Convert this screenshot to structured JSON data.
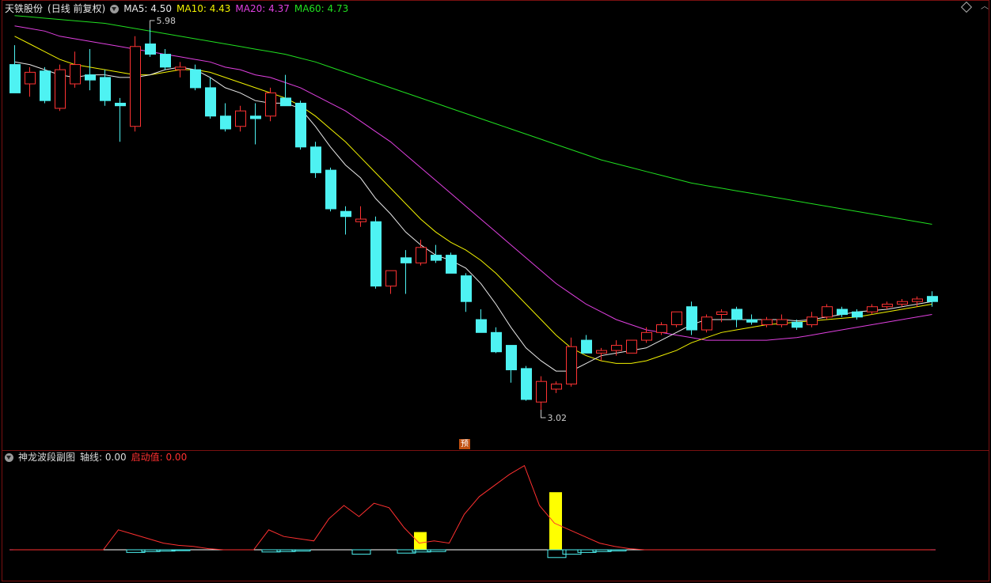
{
  "main_chart": {
    "stock_name": "天铁股份",
    "period_label": "(日线 前复权)",
    "indicators": [
      {
        "label": "MA5:",
        "value": "4.50",
        "color": "#e8e8e8"
      },
      {
        "label": "MA10:",
        "value": "4.43",
        "color": "#f2f200"
      },
      {
        "label": "MA20:",
        "value": "4.37",
        "color": "#e040e0"
      },
      {
        "label": "MA60:",
        "value": "4.73",
        "color": "#20e020"
      }
    ],
    "high_marker": "5.98",
    "low_marker": "3.02",
    "forecast_badge": "预"
  },
  "sub_chart": {
    "title": "神龙波段副图",
    "axis_label": "轴线:",
    "axis_value": "0.00",
    "trigger_label": "启动值:",
    "trigger_value": "0.00"
  },
  "colors": {
    "up": "#ff3333",
    "down": "#4ef2f2",
    "ma5": "#e8e8e8",
    "ma10": "#f2f200",
    "ma20": "#e040e0",
    "ma60": "#20e020",
    "frame": "#7a1010"
  },
  "chart_data": {
    "type": "candlestick",
    "price_range": [
      3.02,
      5.98
    ],
    "candles": [
      {
        "o": 5.7,
        "h": 5.85,
        "l": 5.5,
        "c": 5.48,
        "dir": "down"
      },
      {
        "o": 5.55,
        "h": 5.68,
        "l": 5.45,
        "c": 5.64,
        "dir": "up"
      },
      {
        "o": 5.65,
        "h": 5.68,
        "l": 5.4,
        "c": 5.42,
        "dir": "down"
      },
      {
        "o": 5.36,
        "h": 5.7,
        "l": 5.34,
        "c": 5.66,
        "dir": "up"
      },
      {
        "o": 5.55,
        "h": 5.8,
        "l": 5.52,
        "c": 5.7,
        "dir": "up"
      },
      {
        "o": 5.62,
        "h": 5.82,
        "l": 5.5,
        "c": 5.58,
        "dir": "down"
      },
      {
        "o": 5.6,
        "h": 5.66,
        "l": 5.38,
        "c": 5.42,
        "dir": "down"
      },
      {
        "o": 5.4,
        "h": 5.44,
        "l": 5.1,
        "c": 5.38,
        "dir": "down"
      },
      {
        "o": 5.22,
        "h": 5.92,
        "l": 5.18,
        "c": 5.84,
        "dir": "up"
      },
      {
        "o": 5.86,
        "h": 5.98,
        "l": 5.76,
        "c": 5.78,
        "dir": "down"
      },
      {
        "o": 5.78,
        "h": 5.82,
        "l": 5.66,
        "c": 5.68,
        "dir": "down"
      },
      {
        "o": 5.68,
        "h": 5.72,
        "l": 5.6,
        "c": 5.66,
        "dir": "up"
      },
      {
        "o": 5.66,
        "h": 5.7,
        "l": 5.5,
        "c": 5.52,
        "dir": "down"
      },
      {
        "o": 5.52,
        "h": 5.6,
        "l": 5.28,
        "c": 5.3,
        "dir": "down"
      },
      {
        "o": 5.3,
        "h": 5.4,
        "l": 5.18,
        "c": 5.2,
        "dir": "down"
      },
      {
        "o": 5.22,
        "h": 5.38,
        "l": 5.18,
        "c": 5.34,
        "dir": "up"
      },
      {
        "o": 5.3,
        "h": 5.4,
        "l": 5.08,
        "c": 5.28,
        "dir": "down"
      },
      {
        "o": 5.3,
        "h": 5.52,
        "l": 5.26,
        "c": 5.48,
        "dir": "up"
      },
      {
        "o": 5.44,
        "h": 5.62,
        "l": 5.38,
        "c": 5.38,
        "dir": "down"
      },
      {
        "o": 5.4,
        "h": 5.42,
        "l": 5.04,
        "c": 5.06,
        "dir": "down"
      },
      {
        "o": 5.06,
        "h": 5.1,
        "l": 4.82,
        "c": 4.86,
        "dir": "down"
      },
      {
        "o": 4.88,
        "h": 4.9,
        "l": 4.56,
        "c": 4.58,
        "dir": "down"
      },
      {
        "o": 4.56,
        "h": 4.6,
        "l": 4.38,
        "c": 4.52,
        "dir": "down"
      },
      {
        "o": 4.48,
        "h": 4.6,
        "l": 4.44,
        "c": 4.5,
        "dir": "up"
      },
      {
        "o": 4.48,
        "h": 4.52,
        "l": 3.96,
        "c": 3.98,
        "dir": "down"
      },
      {
        "o": 3.98,
        "h": 4.1,
        "l": 3.92,
        "c": 4.1,
        "dir": "up"
      },
      {
        "o": 4.2,
        "h": 4.26,
        "l": 3.92,
        "c": 4.16,
        "dir": "down"
      },
      {
        "o": 4.16,
        "h": 4.34,
        "l": 4.14,
        "c": 4.28,
        "dir": "up"
      },
      {
        "o": 4.22,
        "h": 4.3,
        "l": 4.16,
        "c": 4.18,
        "dir": "down"
      },
      {
        "o": 4.22,
        "h": 4.24,
        "l": 4.08,
        "c": 4.08,
        "dir": "down"
      },
      {
        "o": 4.06,
        "h": 4.08,
        "l": 3.78,
        "c": 3.86,
        "dir": "down"
      },
      {
        "o": 3.72,
        "h": 3.8,
        "l": 3.66,
        "c": 3.62,
        "dir": "down"
      },
      {
        "o": 3.62,
        "h": 3.66,
        "l": 3.46,
        "c": 3.47,
        "dir": "down"
      },
      {
        "o": 3.52,
        "h": 3.52,
        "l": 3.23,
        "c": 3.33,
        "dir": "down"
      },
      {
        "o": 3.34,
        "h": 3.36,
        "l": 3.09,
        "c": 3.1,
        "dir": "down"
      },
      {
        "o": 3.08,
        "h": 3.28,
        "l": 3.02,
        "c": 3.24,
        "dir": "up"
      },
      {
        "o": 3.18,
        "h": 3.24,
        "l": 3.15,
        "c": 3.22,
        "dir": "up"
      },
      {
        "o": 3.22,
        "h": 3.58,
        "l": 3.2,
        "c": 3.51,
        "dir": "up"
      },
      {
        "o": 3.56,
        "h": 3.6,
        "l": 3.46,
        "c": 3.46,
        "dir": "down"
      },
      {
        "o": 3.46,
        "h": 3.5,
        "l": 3.4,
        "c": 3.48,
        "dir": "up"
      },
      {
        "o": 3.48,
        "h": 3.56,
        "l": 3.44,
        "c": 3.52,
        "dir": "up"
      },
      {
        "o": 3.46,
        "h": 3.56,
        "l": 3.46,
        "c": 3.56,
        "dir": "up"
      },
      {
        "o": 3.56,
        "h": 3.66,
        "l": 3.54,
        "c": 3.62,
        "dir": "up"
      },
      {
        "o": 3.62,
        "h": 3.7,
        "l": 3.6,
        "c": 3.68,
        "dir": "up"
      },
      {
        "o": 3.68,
        "h": 3.78,
        "l": 3.66,
        "c": 3.78,
        "dir": "up"
      },
      {
        "o": 3.82,
        "h": 3.86,
        "l": 3.6,
        "c": 3.64,
        "dir": "down"
      },
      {
        "o": 3.64,
        "h": 3.76,
        "l": 3.62,
        "c": 3.74,
        "dir": "up"
      },
      {
        "o": 3.76,
        "h": 3.8,
        "l": 3.7,
        "c": 3.78,
        "dir": "up"
      },
      {
        "o": 3.8,
        "h": 3.82,
        "l": 3.66,
        "c": 3.72,
        "dir": "down"
      },
      {
        "o": 3.72,
        "h": 3.76,
        "l": 3.68,
        "c": 3.7,
        "dir": "down"
      },
      {
        "o": 3.68,
        "h": 3.74,
        "l": 3.66,
        "c": 3.72,
        "dir": "up"
      },
      {
        "o": 3.68,
        "h": 3.76,
        "l": 3.66,
        "c": 3.72,
        "dir": "up"
      },
      {
        "o": 3.7,
        "h": 3.72,
        "l": 3.64,
        "c": 3.66,
        "dir": "down"
      },
      {
        "o": 3.68,
        "h": 3.78,
        "l": 3.66,
        "c": 3.74,
        "dir": "up"
      },
      {
        "o": 3.74,
        "h": 3.84,
        "l": 3.72,
        "c": 3.82,
        "dir": "up"
      },
      {
        "o": 3.8,
        "h": 3.82,
        "l": 3.74,
        "c": 3.76,
        "dir": "down"
      },
      {
        "o": 3.78,
        "h": 3.8,
        "l": 3.72,
        "c": 3.74,
        "dir": "down"
      },
      {
        "o": 3.78,
        "h": 3.84,
        "l": 3.76,
        "c": 3.82,
        "dir": "up"
      },
      {
        "o": 3.82,
        "h": 3.86,
        "l": 3.8,
        "c": 3.84,
        "dir": "up"
      },
      {
        "o": 3.84,
        "h": 3.88,
        "l": 3.82,
        "c": 3.86,
        "dir": "up"
      },
      {
        "o": 3.86,
        "h": 3.9,
        "l": 3.82,
        "c": 3.88,
        "dir": "up"
      },
      {
        "o": 3.9,
        "h": 3.94,
        "l": 3.82,
        "c": 3.86,
        "dir": "down"
      }
    ],
    "ma5": [
      5.72,
      5.7,
      5.66,
      5.62,
      5.6,
      5.62,
      5.62,
      5.6,
      5.6,
      5.62,
      5.66,
      5.68,
      5.66,
      5.6,
      5.52,
      5.48,
      5.42,
      5.4,
      5.4,
      5.36,
      5.22,
      5.06,
      4.92,
      4.82,
      4.66,
      4.54,
      4.4,
      4.3,
      4.22,
      4.18,
      4.12,
      4.0,
      3.84,
      3.66,
      3.5,
      3.4,
      3.32,
      3.32,
      3.38,
      3.44,
      3.46,
      3.48,
      3.5,
      3.56,
      3.62,
      3.68,
      3.72,
      3.72,
      3.72,
      3.72,
      3.72,
      3.72,
      3.71,
      3.72,
      3.74,
      3.76,
      3.78,
      3.79,
      3.8,
      3.82,
      3.84,
      3.86
    ],
    "ma10": [
      5.92,
      5.86,
      5.8,
      5.74,
      5.7,
      5.68,
      5.66,
      5.64,
      5.62,
      5.62,
      5.64,
      5.66,
      5.66,
      5.64,
      5.6,
      5.56,
      5.52,
      5.48,
      5.44,
      5.38,
      5.3,
      5.2,
      5.1,
      4.98,
      4.86,
      4.74,
      4.62,
      4.5,
      4.4,
      4.32,
      4.26,
      4.18,
      4.08,
      3.96,
      3.84,
      3.72,
      3.6,
      3.5,
      3.44,
      3.4,
      3.38,
      3.38,
      3.4,
      3.44,
      3.48,
      3.54,
      3.58,
      3.62,
      3.64,
      3.66,
      3.68,
      3.69,
      3.7,
      3.71,
      3.72,
      3.73,
      3.74,
      3.76,
      3.78,
      3.8,
      3.82,
      3.84
    ],
    "ma20": [
      6.0,
      5.98,
      5.96,
      5.92,
      5.9,
      5.88,
      5.86,
      5.84,
      5.82,
      5.8,
      5.78,
      5.76,
      5.74,
      5.72,
      5.68,
      5.66,
      5.62,
      5.6,
      5.56,
      5.52,
      5.46,
      5.4,
      5.34,
      5.26,
      5.18,
      5.1,
      5.0,
      4.9,
      4.8,
      4.7,
      4.6,
      4.5,
      4.4,
      4.3,
      4.2,
      4.1,
      4.0,
      3.92,
      3.84,
      3.78,
      3.72,
      3.68,
      3.64,
      3.62,
      3.6,
      3.58,
      3.56,
      3.56,
      3.56,
      3.56,
      3.56,
      3.57,
      3.58,
      3.6,
      3.62,
      3.64,
      3.66,
      3.68,
      3.7,
      3.72,
      3.74,
      3.76
    ],
    "ma60": [
      6.08,
      6.07,
      6.06,
      6.05,
      6.04,
      6.03,
      6.02,
      6.0,
      5.98,
      5.96,
      5.94,
      5.92,
      5.9,
      5.88,
      5.86,
      5.84,
      5.82,
      5.8,
      5.78,
      5.75,
      5.72,
      5.68,
      5.64,
      5.6,
      5.56,
      5.52,
      5.48,
      5.44,
      5.4,
      5.36,
      5.32,
      5.28,
      5.24,
      5.2,
      5.16,
      5.12,
      5.08,
      5.04,
      5.0,
      4.96,
      4.93,
      4.9,
      4.87,
      4.84,
      4.81,
      4.78,
      4.76,
      4.74,
      4.72,
      4.7,
      4.68,
      4.66,
      4.64,
      4.62,
      4.6,
      4.58,
      4.56,
      4.54,
      4.52,
      4.5,
      4.48,
      4.46
    ],
    "sub_red_line": [
      0,
      0,
      0,
      0,
      0,
      0,
      0,
      0.9,
      0.7,
      0.5,
      0.3,
      0.2,
      0.15,
      0.05,
      0,
      0,
      0,
      0.9,
      0.6,
      0.5,
      0.4,
      1.4,
      2.0,
      1.5,
      2.1,
      1.9,
      1.0,
      0.3,
      0.4,
      0.3,
      1.6,
      2.4,
      2.9,
      3.4,
      3.8,
      2.0,
      1.2,
      0.9,
      0.6,
      0.3,
      0.15,
      0.05,
      0,
      0,
      0,
      0,
      0,
      0,
      0,
      0,
      0,
      0,
      0,
      0,
      0,
      0,
      0,
      0,
      0,
      0,
      0,
      0
    ],
    "sub_cyan_blocks": [
      {
        "i": 8,
        "v": -0.12
      },
      {
        "i": 9,
        "v": -0.08
      },
      {
        "i": 10,
        "v": -0.06
      },
      {
        "i": 11,
        "v": -0.04
      },
      {
        "i": 17,
        "v": -0.1
      },
      {
        "i": 18,
        "v": -0.08
      },
      {
        "i": 19,
        "v": -0.06
      },
      {
        "i": 23,
        "v": -0.2
      },
      {
        "i": 26,
        "v": -0.15
      },
      {
        "i": 27,
        "v": -0.1
      },
      {
        "i": 28,
        "v": -0.08
      },
      {
        "i": 36,
        "v": -0.35
      },
      {
        "i": 37,
        "v": -0.2
      },
      {
        "i": 38,
        "v": -0.12
      },
      {
        "i": 39,
        "v": -0.08
      },
      {
        "i": 40,
        "v": -0.05
      }
    ],
    "sub_yellow_bars": [
      {
        "i": 27,
        "v": 0.8
      },
      {
        "i": 36,
        "v": 2.6
      }
    ]
  }
}
